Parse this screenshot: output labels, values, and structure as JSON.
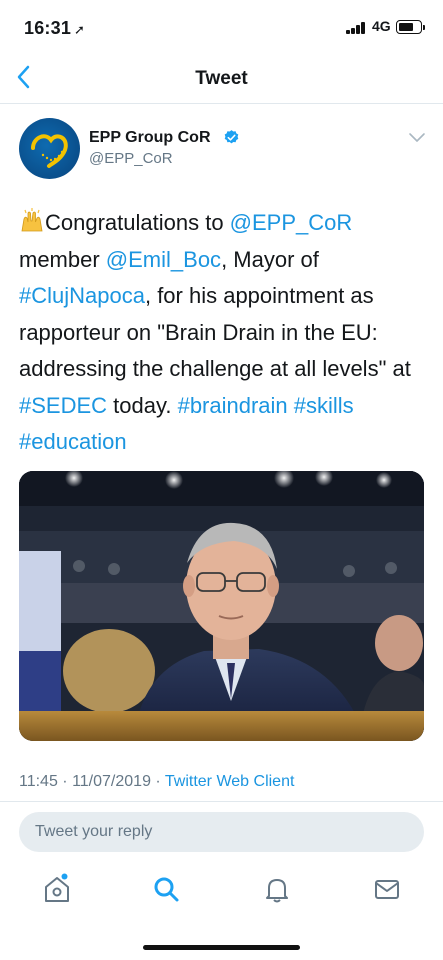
{
  "status_bar": {
    "time": "16:31",
    "network": "4G"
  },
  "nav": {
    "title": "Tweet"
  },
  "tweet": {
    "author_name": "EPP Group CoR",
    "author_handle": "@EPP_CoR",
    "text_segments": [
      {
        "text": "Congratulations to ",
        "type": "text"
      },
      {
        "text": "@EPP_CoR",
        "type": "link"
      },
      {
        "text": " member ",
        "type": "text"
      },
      {
        "text": "@Emil_Boc",
        "type": "link"
      },
      {
        "text": ", Mayor of ",
        "type": "text"
      },
      {
        "text": "#ClujNapoca",
        "type": "link"
      },
      {
        "text": ", for his appointment as rapporteur on \"Brain Drain in the EU: addressing the challenge at all levels\" at ",
        "type": "text"
      },
      {
        "text": "#SEDEC",
        "type": "link"
      },
      {
        "text": " today. ",
        "type": "text"
      },
      {
        "text": "#braindrain",
        "type": "link"
      },
      {
        "text": " ",
        "type": "text"
      },
      {
        "text": "#skills",
        "type": "link"
      },
      {
        "text": " ",
        "type": "text"
      },
      {
        "text": "#education",
        "type": "link"
      }
    ],
    "timestamp": "11:45 · 11/07/2019 · ",
    "client": "Twitter Web Client"
  },
  "reply": {
    "placeholder": "Tweet your reply"
  },
  "tab_bar": {
    "items": [
      "home-icon",
      "search-icon",
      "notifications-icon",
      "messages-icon"
    ]
  },
  "colors": {
    "link": "#1b95e0",
    "secondary_text": "#657786",
    "primary_text": "#14171a",
    "divider": "#e1e8ed"
  }
}
